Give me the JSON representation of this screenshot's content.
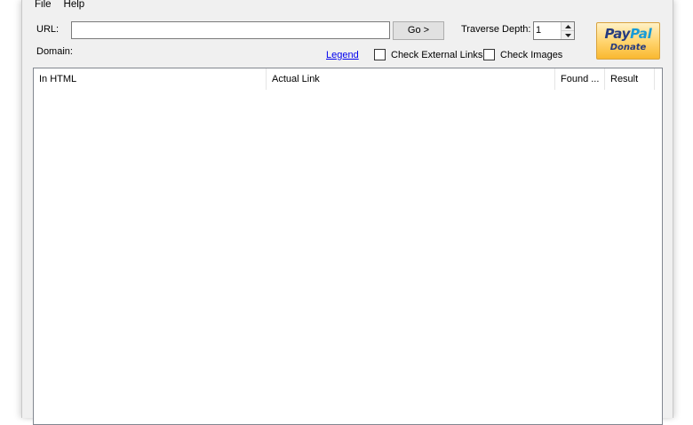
{
  "menubar": {
    "items": [
      {
        "label": "File"
      },
      {
        "label": "Help"
      }
    ]
  },
  "form": {
    "url_label": "URL:",
    "url_value": "",
    "go_label": "Go >",
    "depth_label": "Traverse Depth:",
    "depth_value": "1",
    "domain_label": "Domain:",
    "legend_label": "Legend",
    "check_external_label": "Check External Links",
    "check_external_checked": false,
    "check_images_label": "Check Images",
    "check_images_checked": false
  },
  "donate": {
    "logo_pay": "Pay",
    "logo_pal": "Pal",
    "label": "Donate",
    "colors": {
      "dark_blue": "#253b80",
      "light_blue": "#179bd7",
      "gold": "#ffd36b"
    }
  },
  "results_table": {
    "columns": [
      {
        "label": "In HTML"
      },
      {
        "label": "Actual Link"
      },
      {
        "label": "Found ..."
      },
      {
        "label": "Result"
      }
    ],
    "rows": []
  },
  "colors": {
    "window_bg": "#f0f0f0",
    "link": "#0000ee"
  }
}
